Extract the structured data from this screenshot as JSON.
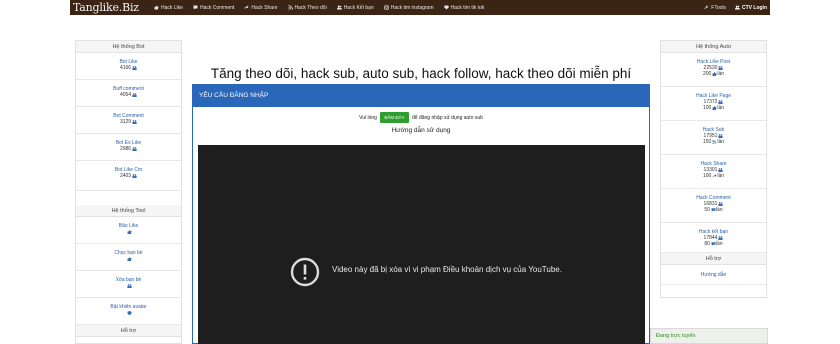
{
  "navbar": {
    "brand": "Tanglike.Biz",
    "items": [
      {
        "label": "Hack Like",
        "icon": "thumbs-up-icon"
      },
      {
        "label": "Hack Comment",
        "icon": "comment-icon"
      },
      {
        "label": "Hack Share",
        "icon": "share-icon"
      },
      {
        "label": "Hack Theo dõi",
        "icon": "rss-icon"
      },
      {
        "label": "Hack Kết bạn",
        "icon": "users-icon"
      },
      {
        "label": "Hack tim instagram",
        "icon": "instagram-icon"
      },
      {
        "label": "Hack tim tik tok",
        "icon": "heart-icon"
      }
    ],
    "right": [
      {
        "label": "FTools",
        "icon": "wrench-icon"
      },
      {
        "label": "CTV Login",
        "icon": "users-icon"
      }
    ]
  },
  "left_sidebar": {
    "sections": [
      {
        "title": "Hệ thống Bot",
        "items": [
          {
            "label": "Bot Like",
            "count": "4166"
          },
          {
            "label": "Buff comment",
            "count": "4054"
          },
          {
            "label": "Bot Comment",
            "count": "3129"
          },
          {
            "label": "Bot Ex Like",
            "count": "2986"
          },
          {
            "label": "Bot Like Cm",
            "count": "2403"
          }
        ]
      },
      {
        "title": "Hệ thống Tool",
        "items": [
          {
            "label": "Bão Like"
          },
          {
            "label": "Chọc bạn bè"
          },
          {
            "label": "Xóa bạn bè"
          },
          {
            "label": "Bật khiên avatar"
          }
        ]
      },
      {
        "title": "Hỗ trợ",
        "items": []
      }
    ]
  },
  "right_sidebar": {
    "sections": [
      {
        "title": "Hệ thống Auto",
        "items": [
          {
            "label": "Hack Like Post",
            "count": "22530",
            "limit": "200",
            "unit": "lần"
          },
          {
            "label": "Hack Like Page",
            "count": "17372",
            "limit": "100",
            "unit": "lần"
          },
          {
            "label": "Hack Sub",
            "count": "17951",
            "limit": "150",
            "unit": "lần"
          },
          {
            "label": "Hack Share",
            "count": "13301",
            "limit": "100",
            "unit": "lần"
          },
          {
            "label": "Hack Comment",
            "count": "16831",
            "limit": "50",
            "unit": "lần"
          },
          {
            "label": "Hack kết bạn",
            "count": "17844",
            "limit": "80",
            "unit": "lần"
          }
        ]
      },
      {
        "title": "Hỗ trợ",
        "items": [
          {
            "label": "Hướng dẫn"
          }
        ]
      }
    ]
  },
  "main": {
    "title": "Tăng theo dõi, hack sub, auto sub, hack follow, hack theo dõi miễn phí",
    "panel_title": "YÊU CẦU ĐĂNG NHẬP",
    "login_prefix": "Vui lòng",
    "login_button": "BẤM ĐÂY",
    "login_suffix": "để đăng nhập sử dụng auto sub",
    "guide_title": "Hướng dẫn sử dụng",
    "video_message": "Video này đã bị xóa vì vi phạm Điều khoản dịch vụ của YouTube."
  },
  "online": {
    "label": "Đang trực tuyến"
  },
  "colors": {
    "navbar": "#3b2414",
    "primary": "#2a67b8",
    "button": "#2e9e2f",
    "video_bg": "#1e1e1e"
  }
}
